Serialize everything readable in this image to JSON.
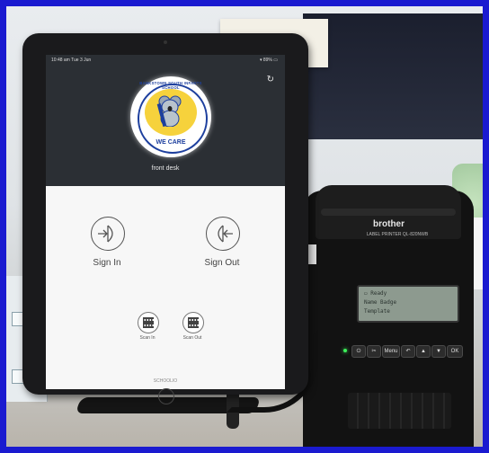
{
  "tablet": {
    "status_time": "10:48 am  Tue 3 Jun",
    "status_right": "▾ 89% ▭",
    "logo": {
      "top_text": "BANKSTOWN SOUTH INFANTS SCHOOL",
      "bottom_text": "WE CARE"
    },
    "location": "front desk",
    "sign_in_label": "Sign In",
    "sign_out_label": "Sign Out",
    "scan_in_label": "Scan In",
    "scan_out_label": "Scan Out",
    "footer_brand": "SCHOOLIO",
    "icons": {
      "refresh": "↻",
      "sign_in": "enter-door-icon",
      "sign_out": "exit-door-icon",
      "qr": "qr-code-icon"
    }
  },
  "printer": {
    "brand": "brother",
    "model": "LABEL PRINTER QL-820NWB",
    "lcd_lines": [
      "▭ Ready",
      "Name Badge",
      "Template"
    ],
    "buttons": [
      "⏻",
      "✂",
      "Menu",
      "↶",
      "▲",
      "▼",
      "OK"
    ]
  },
  "colors": {
    "frame": "#1a1ad0",
    "school_blue": "#1d3f9e",
    "koala_yellow": "#f6d23c",
    "led_green": "#3df05a"
  }
}
